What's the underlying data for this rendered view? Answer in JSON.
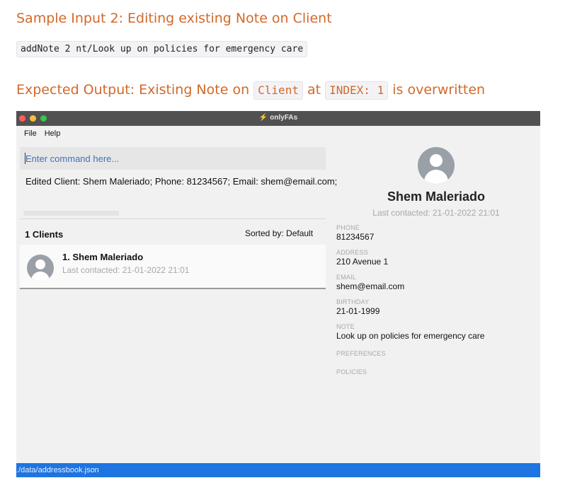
{
  "doc": {
    "heading1": "Sample Input 2: Editing existing Note on Client",
    "command": "addNote 2 nt/Look up on policies for emergency care",
    "heading2": {
      "prefix": "Expected Output: Existing Note on",
      "code1": "Client",
      "mid": "at",
      "code2": "INDEX: 1",
      "suffix": "is overwritten"
    }
  },
  "window": {
    "title": "onlyFAs",
    "menu": [
      "File",
      "Help"
    ],
    "command_placeholder": "Enter command here...",
    "result": "Edited Client: Shem Maleriado; Phone: 81234567; Email: shem@email.com;",
    "list": {
      "count_label": "1 Clients",
      "sort_label": "Sorted by: Default",
      "items": [
        {
          "title": "1.  Shem Maleriado",
          "last_contacted": "Last contacted: 21-01-2022 21:01"
        }
      ]
    },
    "detail": {
      "name": "Shem Maleriado",
      "last_contacted": "Last contacted: 21-01-2022 21:01",
      "fields": {
        "phone_label": "PHONE",
        "phone": "81234567",
        "address_label": "ADDRESS",
        "address": "210 Avenue 1",
        "email_label": "EMAIL",
        "email": "shem@email.com",
        "birthday_label": "BIRTHDAY",
        "birthday": "21-01-1999",
        "note_label": "NOTE",
        "note": "Look up on policies for emergency care",
        "preferences_label": "PREFERENCES",
        "policies_label": "POLICIES"
      }
    },
    "status_path": "./data/addressbook.json"
  },
  "colors": {
    "heading": "#d2692a",
    "status_bar": "#1e74e0",
    "titlebar": "#515151"
  }
}
